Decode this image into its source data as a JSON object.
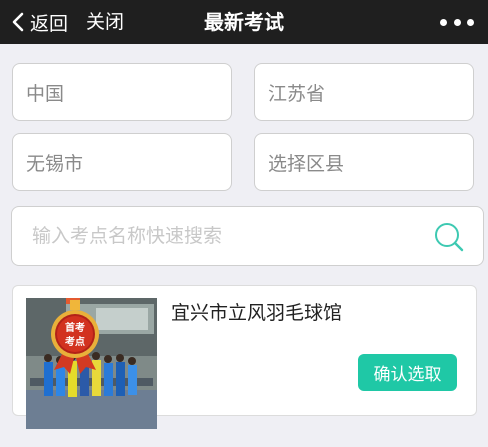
{
  "nav": {
    "back_label": "返回",
    "close_label": "关闭",
    "title": "最新考试"
  },
  "filters": {
    "country": "中国",
    "province": "江苏省",
    "city": "无锡市",
    "district_placeholder": "选择区县"
  },
  "search": {
    "placeholder": "输入考点名称快速搜索"
  },
  "results": [
    {
      "name": "宜兴市立风羽毛球馆",
      "badge_line1": "首考",
      "badge_line2": "考点",
      "select_label": "确认选取"
    }
  ],
  "colors": {
    "nav_bg": "#1f1f1f",
    "accent": "#1fc8a6",
    "search_icon": "#3dc9b2",
    "page_bg": "#efeff4"
  },
  "icons": {
    "back": "chevron-left-icon",
    "more": "more-dots-icon",
    "search": "search-icon",
    "badge": "medal-badge-icon"
  }
}
